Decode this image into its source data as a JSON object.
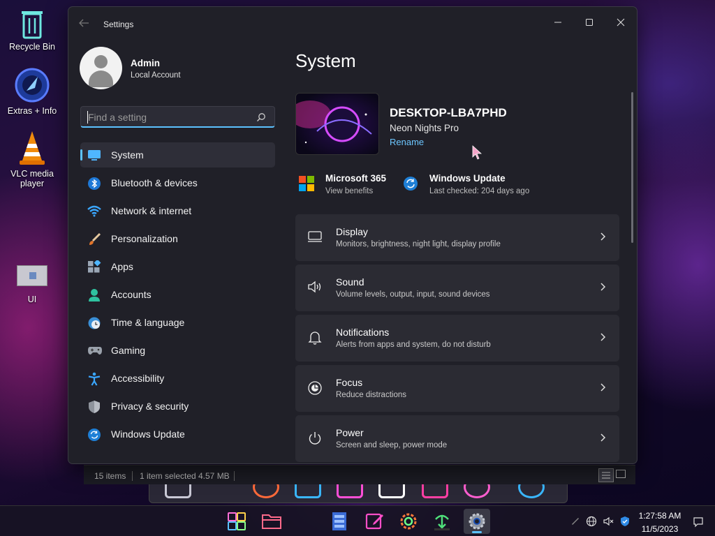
{
  "desktop": {
    "icons": [
      {
        "label": "Recycle Bin"
      },
      {
        "label": "Extras + Info"
      },
      {
        "label": "VLC media player"
      },
      {
        "label": "UI"
      }
    ]
  },
  "explorer_status": {
    "items": "15 items",
    "selected": "1 item selected",
    "size": "4.57 MB"
  },
  "window": {
    "title": "Settings"
  },
  "profile": {
    "name": "Admin",
    "account_type": "Local Account"
  },
  "search": {
    "placeholder": "Find a setting"
  },
  "nav": [
    {
      "label": "System",
      "icon": "system-icon",
      "active": true
    },
    {
      "label": "Bluetooth & devices",
      "icon": "bluetooth-icon"
    },
    {
      "label": "Network & internet",
      "icon": "wifi-icon"
    },
    {
      "label": "Personalization",
      "icon": "brush-icon"
    },
    {
      "label": "Apps",
      "icon": "apps-icon"
    },
    {
      "label": "Accounts",
      "icon": "person-icon"
    },
    {
      "label": "Time & language",
      "icon": "clock-globe-icon"
    },
    {
      "label": "Gaming",
      "icon": "gamepad-icon"
    },
    {
      "label": "Accessibility",
      "icon": "accessibility-icon"
    },
    {
      "label": "Privacy & security",
      "icon": "shield-icon"
    },
    {
      "label": "Windows Update",
      "icon": "sync-icon"
    }
  ],
  "page": {
    "title": "System",
    "device_name": "DESKTOP-LBA7PHD",
    "device_model": "Neon Nights Pro",
    "rename_label": "Rename",
    "quick": [
      {
        "title": "Microsoft 365",
        "subtitle": "View benefits",
        "icon": "microsoft-logo-icon"
      },
      {
        "title": "Windows Update",
        "subtitle": "Last checked: 204 days ago",
        "icon": "update-icon"
      }
    ],
    "cards": [
      {
        "title": "Display",
        "subtitle": "Monitors, brightness, night light, display profile",
        "icon": "monitor-icon"
      },
      {
        "title": "Sound",
        "subtitle": "Volume levels, output, input, sound devices",
        "icon": "speaker-icon"
      },
      {
        "title": "Notifications",
        "subtitle": "Alerts from apps and system, do not disturb",
        "icon": "bell-icon"
      },
      {
        "title": "Focus",
        "subtitle": "Reduce distractions",
        "icon": "focus-icon"
      },
      {
        "title": "Power",
        "subtitle": "Screen and sleep, power mode",
        "icon": "power-icon"
      }
    ]
  },
  "taskbar": {
    "time": "1:27:58 AM",
    "date": "11/5/2023"
  },
  "colors": {
    "accent": "#5cc2ff",
    "window_bg": "#202028",
    "card_bg": "#2b2b33"
  }
}
